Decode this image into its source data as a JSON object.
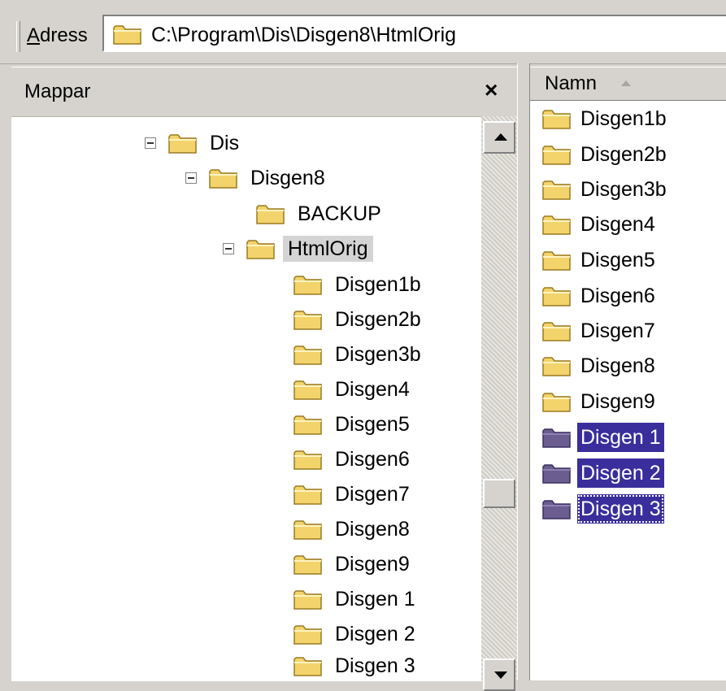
{
  "address": {
    "label": "Adress",
    "path": "C:\\Program\\Dis\\Disgen8\\HtmlOrig"
  },
  "folders_pane": {
    "title": "Mappar",
    "close_label": "×",
    "tree": [
      {
        "label": "Dis",
        "expanded": true
      },
      {
        "label": "Disgen8",
        "expanded": true
      },
      {
        "label": "BACKUP"
      },
      {
        "label": "HtmlOrig",
        "expanded": true,
        "selected": true
      },
      {
        "label": "Disgen1b"
      },
      {
        "label": "Disgen2b"
      },
      {
        "label": "Disgen3b"
      },
      {
        "label": "Disgen4"
      },
      {
        "label": "Disgen5"
      },
      {
        "label": "Disgen6"
      },
      {
        "label": "Disgen7"
      },
      {
        "label": "Disgen8"
      },
      {
        "label": "Disgen9"
      },
      {
        "label": "Disgen 1"
      },
      {
        "label": "Disgen 2"
      },
      {
        "label": "Disgen 3"
      }
    ]
  },
  "file_list": {
    "column_header": "Namn",
    "items": [
      {
        "label": "Disgen1b"
      },
      {
        "label": "Disgen2b"
      },
      {
        "label": "Disgen3b"
      },
      {
        "label": "Disgen4"
      },
      {
        "label": "Disgen5"
      },
      {
        "label": "Disgen6"
      },
      {
        "label": "Disgen7"
      },
      {
        "label": "Disgen8"
      },
      {
        "label": "Disgen9"
      },
      {
        "label": "Disgen 1",
        "selected": true
      },
      {
        "label": "Disgen 2",
        "selected": true
      },
      {
        "label": "Disgen 3",
        "selected": true,
        "focused": true
      }
    ]
  },
  "colors": {
    "folder_yellow": "#f3d36b",
    "folder_selected": "#6b5d8f",
    "selection": "#3a2e9c",
    "chrome": "#d6d3ce"
  }
}
